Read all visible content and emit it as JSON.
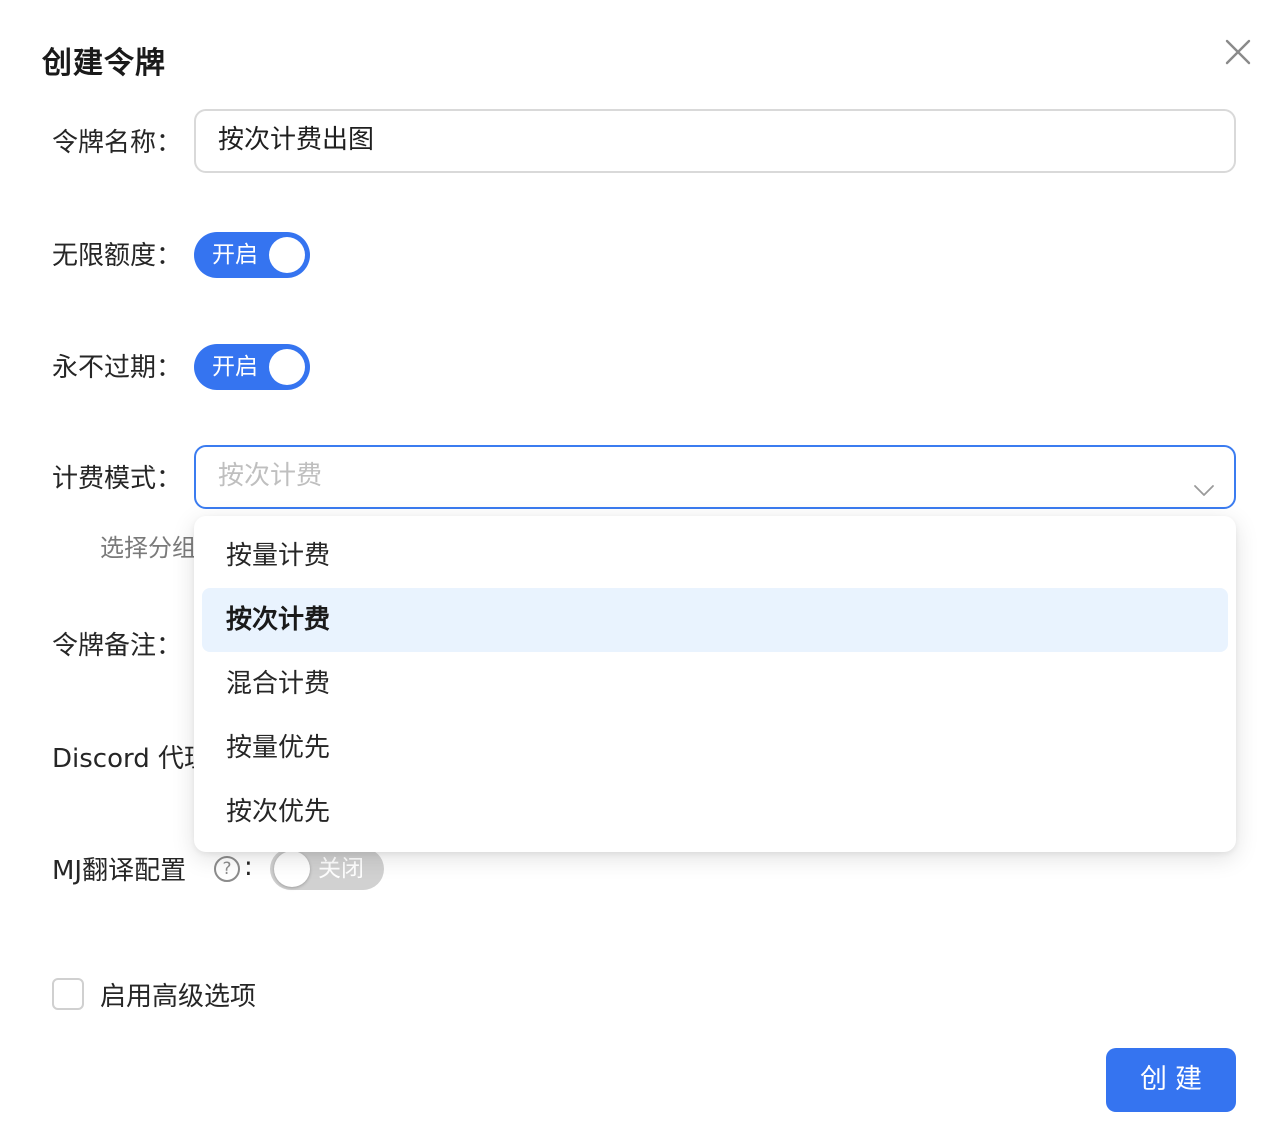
{
  "dialog": {
    "title": "创建令牌",
    "close_icon": "close-icon"
  },
  "form": {
    "token_name": {
      "label": "令牌名称：",
      "value": "按次计费出图"
    },
    "unlimited_quota": {
      "label": "无限额度：",
      "switch_text": "开启",
      "enabled": true
    },
    "never_expire": {
      "label": "永不过期：",
      "switch_text": "开启",
      "enabled": true
    },
    "billing_mode": {
      "label": "计费模式：",
      "placeholder": "按次计费",
      "hint": "选择分组",
      "options": [
        "按量计费",
        "按次计费",
        "混合计费",
        "按量优先",
        "按次优先"
      ],
      "selected_option": "按次计费"
    },
    "token_remark": {
      "label": "令牌备注："
    },
    "discord_proxy": {
      "label": "Discord 代理"
    },
    "mj_translate": {
      "label": "MJ翻译配置",
      "help_icon": "?",
      "colon": ":",
      "switch_text": "关闭",
      "enabled": false
    },
    "advanced": {
      "label": "启用高级选项",
      "checked": false
    }
  },
  "footer": {
    "create_label": "创建"
  },
  "colors": {
    "primary": "#3574f0",
    "selected_bg": "#e9f3fe",
    "switch_off": "#d1d1d1"
  }
}
